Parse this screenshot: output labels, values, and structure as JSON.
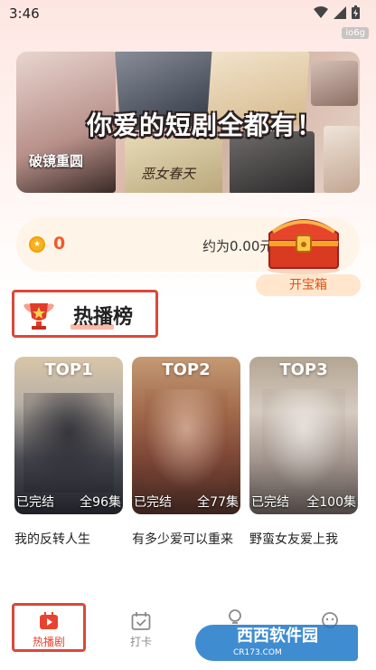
{
  "status_bar": {
    "time": "3:46",
    "badge": "io6g"
  },
  "banner": {
    "title": "你爱的短剧全都有！",
    "sub_left": "破镜重圆",
    "sub_mid": "恶女春天"
  },
  "rewards": {
    "coins": "0",
    "approx": "约为0.00元",
    "chest_button": "开宝箱"
  },
  "hot_list": {
    "title": "热播榜"
  },
  "dramas": [
    {
      "rank": "TOP1",
      "status": "已完结",
      "episodes": "全96集",
      "title": "我的反转人生"
    },
    {
      "rank": "TOP2",
      "status": "已完结",
      "episodes": "全77集",
      "title": "有多少爱可以重来"
    },
    {
      "rank": "TOP3",
      "status": "已完结",
      "episodes": "全100集",
      "title": "野蛮女友爱上我"
    }
  ],
  "nav": [
    {
      "label": "热播剧",
      "icon": "play-tv-icon"
    },
    {
      "label": "打卡",
      "icon": "calendar-check-icon"
    }
  ],
  "watermark": {
    "text": "西西软件园",
    "sub": "CR173.COM"
  },
  "colors": {
    "accent": "#d84a3a",
    "coin": "#f05a2a",
    "banner_bg": "#e8c7bd"
  }
}
